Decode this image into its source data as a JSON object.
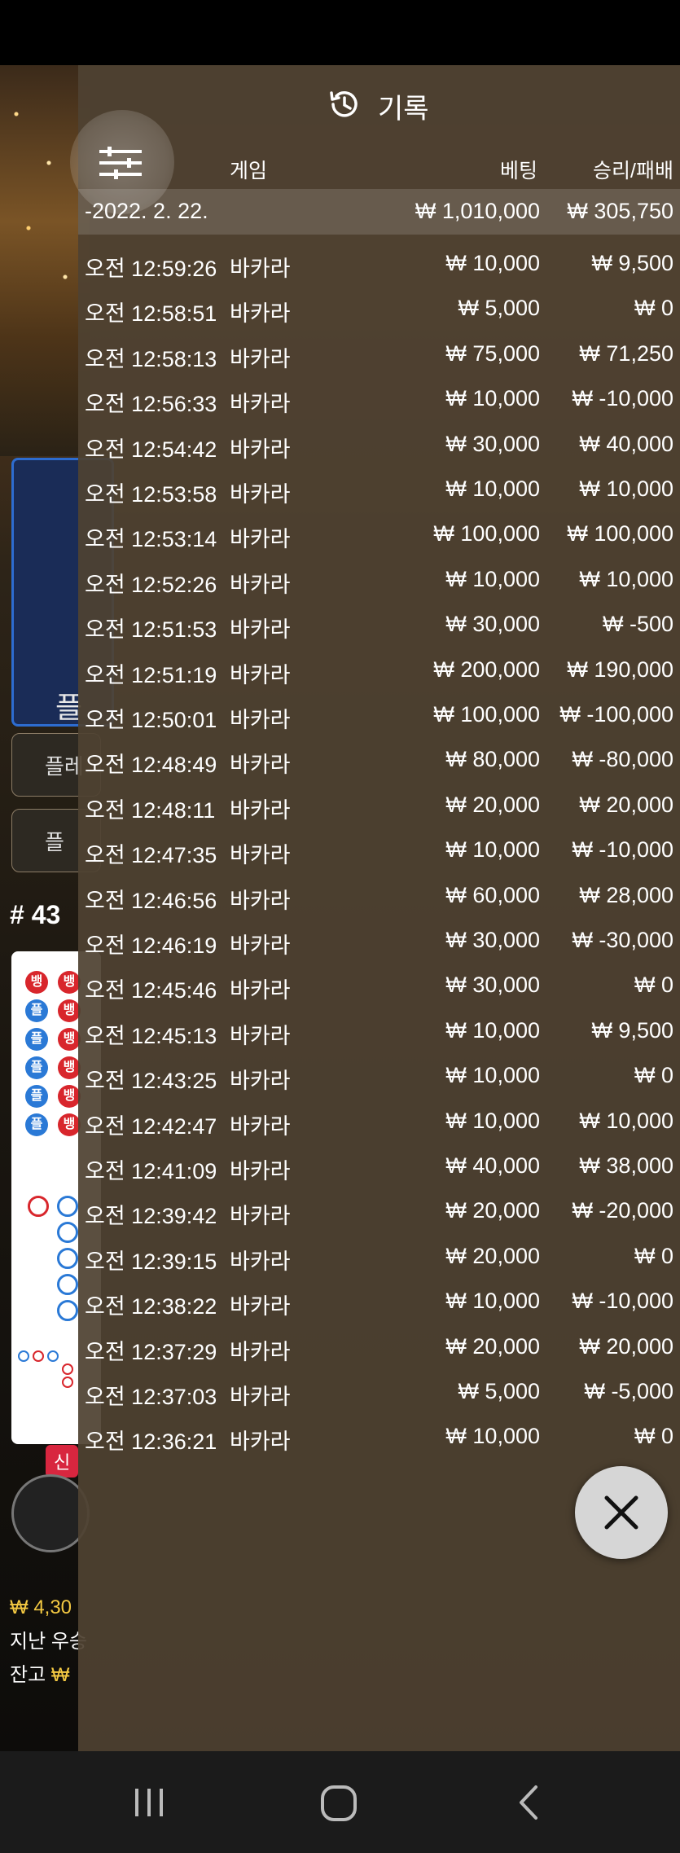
{
  "header": {
    "title": "기록",
    "icon": "history-icon"
  },
  "columns": {
    "game": "게임",
    "bet": "베팅",
    "win_loss": "승리/패배"
  },
  "date_summary": {
    "date": "-2022. 2. 22.",
    "bet": "₩ 1,010,000",
    "win_loss": "₩ 305,750"
  },
  "rows": [
    {
      "time": "오전 12:59:26",
      "game": "바카라",
      "bet": "₩ 10,000",
      "win_loss": "₩ 9,500"
    },
    {
      "time": "오전 12:58:51",
      "game": "바카라",
      "bet": "₩ 5,000",
      "win_loss": "₩ 0"
    },
    {
      "time": "오전 12:58:13",
      "game": "바카라",
      "bet": "₩ 75,000",
      "win_loss": "₩ 71,250"
    },
    {
      "time": "오전 12:56:33",
      "game": "바카라",
      "bet": "₩ 10,000",
      "win_loss": "₩ -10,000"
    },
    {
      "time": "오전 12:54:42",
      "game": "바카라",
      "bet": "₩ 30,000",
      "win_loss": "₩ 40,000"
    },
    {
      "time": "오전 12:53:58",
      "game": "바카라",
      "bet": "₩ 10,000",
      "win_loss": "₩ 10,000"
    },
    {
      "time": "오전 12:53:14",
      "game": "바카라",
      "bet": "₩ 100,000",
      "win_loss": "₩ 100,000"
    },
    {
      "time": "오전 12:52:26",
      "game": "바카라",
      "bet": "₩ 10,000",
      "win_loss": "₩ 10,000"
    },
    {
      "time": "오전 12:51:53",
      "game": "바카라",
      "bet": "₩ 30,000",
      "win_loss": "₩ -500"
    },
    {
      "time": "오전 12:51:19",
      "game": "바카라",
      "bet": "₩ 200,000",
      "win_loss": "₩ 190,000"
    },
    {
      "time": "오전 12:50:01",
      "game": "바카라",
      "bet": "₩ 100,000",
      "win_loss": "₩ -100,000"
    },
    {
      "time": "오전 12:48:49",
      "game": "바카라",
      "bet": "₩ 80,000",
      "win_loss": "₩ -80,000"
    },
    {
      "time": "오전 12:48:11",
      "game": "바카라",
      "bet": "₩ 20,000",
      "win_loss": "₩ 20,000"
    },
    {
      "time": "오전 12:47:35",
      "game": "바카라",
      "bet": "₩ 10,000",
      "win_loss": "₩ -10,000"
    },
    {
      "time": "오전 12:46:56",
      "game": "바카라",
      "bet": "₩ 60,000",
      "win_loss": "₩ 28,000"
    },
    {
      "time": "오전 12:46:19",
      "game": "바카라",
      "bet": "₩ 30,000",
      "win_loss": "₩ -30,000"
    },
    {
      "time": "오전 12:45:46",
      "game": "바카라",
      "bet": "₩ 30,000",
      "win_loss": "₩ 0"
    },
    {
      "time": "오전 12:45:13",
      "game": "바카라",
      "bet": "₩ 10,000",
      "win_loss": "₩ 9,500"
    },
    {
      "time": "오전 12:43:25",
      "game": "바카라",
      "bet": "₩ 10,000",
      "win_loss": "₩ 0"
    },
    {
      "time": "오전 12:42:47",
      "game": "바카라",
      "bet": "₩ 10,000",
      "win_loss": "₩ 10,000"
    },
    {
      "time": "오전 12:41:09",
      "game": "바카라",
      "bet": "₩ 40,000",
      "win_loss": "₩ 38,000"
    },
    {
      "time": "오전 12:39:42",
      "game": "바카라",
      "bet": "₩ 20,000",
      "win_loss": "₩ -20,000"
    },
    {
      "time": "오전 12:39:15",
      "game": "바카라",
      "bet": "₩ 20,000",
      "win_loss": "₩ 0"
    },
    {
      "time": "오전 12:38:22",
      "game": "바카라",
      "bet": "₩ 10,000",
      "win_loss": "₩ -10,000"
    },
    {
      "time": "오전 12:37:29",
      "game": "바카라",
      "bet": "₩ 20,000",
      "win_loss": "₩ 20,000"
    },
    {
      "time": "오전 12:37:03",
      "game": "바카라",
      "bet": "₩ 5,000",
      "win_loss": "₩ -5,000"
    },
    {
      "time": "오전 12:36:21",
      "game": "바카라",
      "bet": "₩ 10,000",
      "win_loss": "₩ 0"
    }
  ],
  "background": {
    "player_label": "플",
    "button_1": "플레",
    "button_2": "플",
    "round": "# 43",
    "bead_banker": "뱅",
    "bead_player": "플",
    "new_badge": "신",
    "total_bet_prefix": "₩ 4,30",
    "last_win_label": "지난 우승",
    "balance_label": "잔고",
    "balance_prefix": "₩"
  },
  "nav": {
    "recent": "recent-apps-icon",
    "home": "home-icon",
    "back": "back-icon"
  },
  "colors": {
    "panel": "#4f4231",
    "accent_gold": "#f3c842",
    "banker_red": "#d8262c",
    "player_blue": "#2a79d6"
  }
}
